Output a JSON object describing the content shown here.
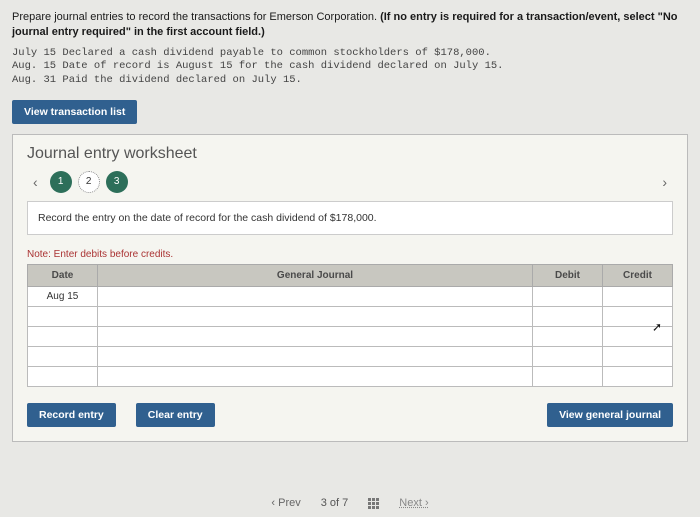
{
  "instructions_prefix": "Prepare journal entries to record the transactions for Emerson Corporation. ",
  "instructions_bold": "(If no entry is required for a transaction/event, select \"No journal entry required\" in the first account field.)",
  "transactions": "July 15 Declared a cash dividend payable to common stockholders of $178,000.\nAug. 15 Date of record is August 15 for the cash dividend declared on July 15.\nAug. 31 Paid the dividend declared on July 15.",
  "view_trans_btn": "View transaction list",
  "worksheet": {
    "title": "Journal entry worksheet",
    "steps": [
      "1",
      "2",
      "3"
    ],
    "current_step": 1,
    "step_instruction": "Record the entry on the date of record for the cash dividend of $178,000.",
    "note": "Note: Enter debits before credits.",
    "headers": {
      "date": "Date",
      "gj": "General Journal",
      "debit": "Debit",
      "credit": "Credit"
    },
    "rows": [
      {
        "date": "Aug 15",
        "gj": "",
        "debit": "",
        "credit": ""
      },
      {
        "date": "",
        "gj": "",
        "debit": "",
        "credit": ""
      },
      {
        "date": "",
        "gj": "",
        "debit": "",
        "credit": ""
      },
      {
        "date": "",
        "gj": "",
        "debit": "",
        "credit": ""
      },
      {
        "date": "",
        "gj": "",
        "debit": "",
        "credit": ""
      }
    ],
    "buttons": {
      "record": "Record entry",
      "clear": "Clear entry",
      "view_gj": "View general journal"
    }
  },
  "paginator": {
    "prev": "Prev",
    "position": "3 of 7",
    "next": "Next"
  }
}
